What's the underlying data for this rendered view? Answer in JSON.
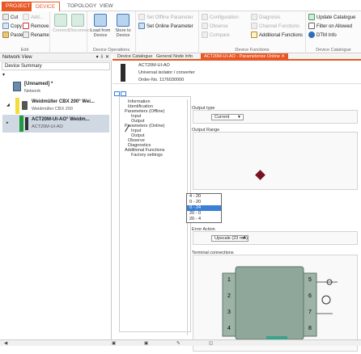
{
  "tabs": [
    "PROJECT",
    "DEVICE",
    "TOPOLOGY",
    "VIEW"
  ],
  "ribbon": {
    "edit": {
      "cut": "Cut",
      "copy": "Copy",
      "paste": "Paste",
      "add": "Add...",
      "remove": "Remove",
      "rename": "Rename",
      "caption": "Edit"
    },
    "connect": "Connect",
    "disconnect": "Disconnect",
    "load_from_device": "Load from Device",
    "store_to_device": "Store to Device",
    "device_ops_caption": "Device Operations",
    "set_offline": "Set Offline Parameter",
    "set_online": "Set Online Parameter",
    "configuration": "Configuration",
    "observe": "Observe",
    "compare": "Compare",
    "diagnosis": "Diagnosis",
    "channel_functions": "Channel Functions",
    "additional_functions": "Additional Functions",
    "device_functions_caption": "Device Functions",
    "update_catalogue": "Update Catalogue",
    "filter_allowed": "Filter on Allowed",
    "dtm_info": "DTM Info",
    "device_catalogue_caption": "Device Catalogue"
  },
  "network_view": {
    "title": "Network View",
    "controls": "▾ ⇩ ✕",
    "summary": "Device Summary",
    "unnamed": "[Unnamed] *",
    "network": "Network",
    "cbx_name": "Weidmüller CBX 200° Wei...",
    "cbx_sub": "Weidmüller CBX 200",
    "act_name": "ACT20M-UI-AO° Weidm...",
    "act_sub": "ACT20M-UI-AO"
  },
  "doc_tabs": [
    "Device Catalogue",
    "General Node Info",
    "ACT20M-UI-AO - Parameterize Online"
  ],
  "device": {
    "name": "ACT20M-UI-AO",
    "desc": "Universal isolator / converter",
    "order": "Order-No. 1176030000"
  },
  "tree": [
    "Information",
    "Identification",
    "Parameters (Offline)",
    "Input",
    "Output",
    "Parameters (Online)",
    "Input",
    "Output",
    "Observe",
    "Diagnostics",
    "Additional Functions",
    "Factory settings"
  ],
  "output_type": {
    "label": "Output type",
    "value": "Current"
  },
  "output_range": {
    "label": "Output Range",
    "options": [
      "4 - 20",
      "0 - 20",
      "0 - 24",
      "20 - 0",
      "20 - 4"
    ],
    "selected": 2
  },
  "error_action": {
    "label": "Error Action",
    "value": "Upscale (23 mA)"
  },
  "terminal": {
    "label": "Terminal connections",
    "numbers": [
      "1",
      "2",
      "3",
      "4",
      "5",
      "6",
      "7",
      "8"
    ]
  },
  "colors": {
    "accent": "#e85826",
    "selection": "#3b7fd6",
    "module": "#8fa79a"
  }
}
